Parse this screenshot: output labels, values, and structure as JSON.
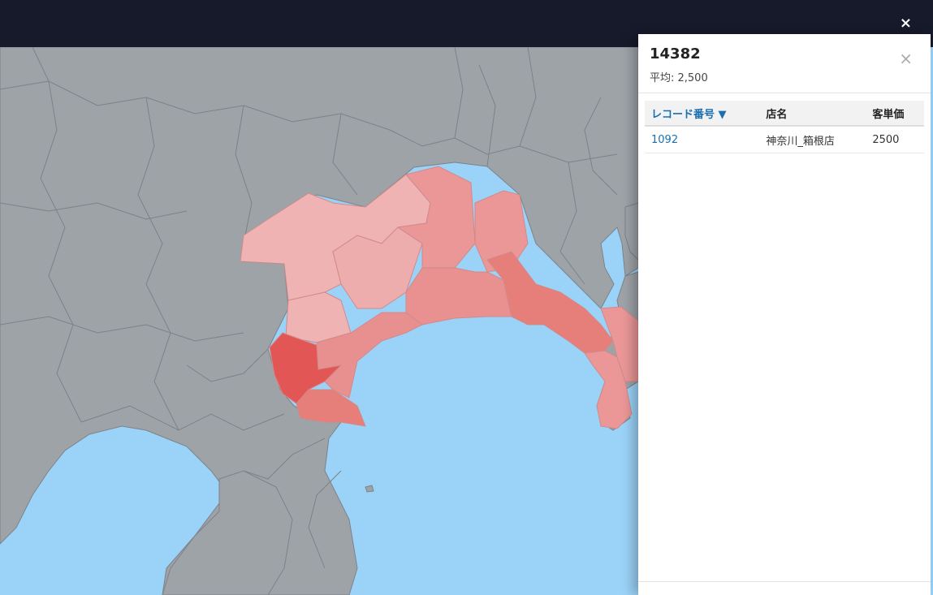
{
  "window": {
    "close_icon": "×"
  },
  "map": {
    "land_color": "#9ea3a8",
    "sea_color": "#9bd3f8",
    "border_color": "#7d8288",
    "highlight_colors": {
      "darkest": "#e35656",
      "dark": "#e67e7a",
      "medium": "#eb9797",
      "light": "#efb3b3"
    }
  },
  "panel": {
    "title": "14382",
    "subtitle": "平均: 2,500",
    "close_icon": "×",
    "table": {
      "headers": {
        "record": "レコード番号 ▼",
        "store": "店名",
        "price": "客単価"
      },
      "rows": [
        {
          "record": "1092",
          "store": "神奈川_箱根店",
          "price": "2500"
        }
      ]
    }
  }
}
